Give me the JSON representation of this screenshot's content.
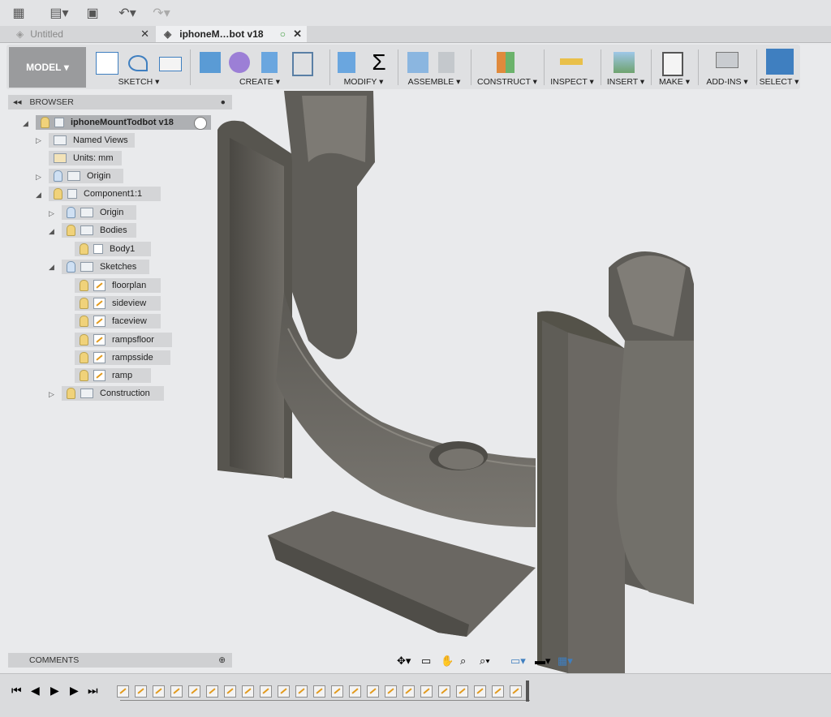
{
  "app": {
    "tabs": [
      {
        "label": "Untitled",
        "active": false
      },
      {
        "label": "iphoneM…bot v18",
        "active": true
      }
    ]
  },
  "toolbar": {
    "workspace": "MODEL",
    "groups": [
      "SKETCH",
      "CREATE",
      "MODIFY",
      "ASSEMBLE",
      "CONSTRUCT",
      "INSPECT",
      "INSERT",
      "MAKE",
      "ADD-INS",
      "SELECT"
    ]
  },
  "browser": {
    "title": "BROWSER",
    "root": "iphoneMountTodbot v18",
    "items": {
      "named_views": "Named Views",
      "units": "Units: mm",
      "origin": "Origin",
      "component": "Component1:1",
      "comp_origin": "Origin",
      "bodies": "Bodies",
      "body1": "Body1",
      "sketches": "Sketches",
      "sk1": "floorplan",
      "sk2": "sideview",
      "sk3": "faceview",
      "sk4": "rampsfloor",
      "sk5": "rampsside",
      "sk6": "ramp",
      "construction": "Construction"
    }
  },
  "comments": {
    "title": "COMMENTS"
  },
  "colors": {
    "accent": "#3f7fc0",
    "body": "#6e6b66",
    "workspace_bg": "#9a9b9d"
  }
}
